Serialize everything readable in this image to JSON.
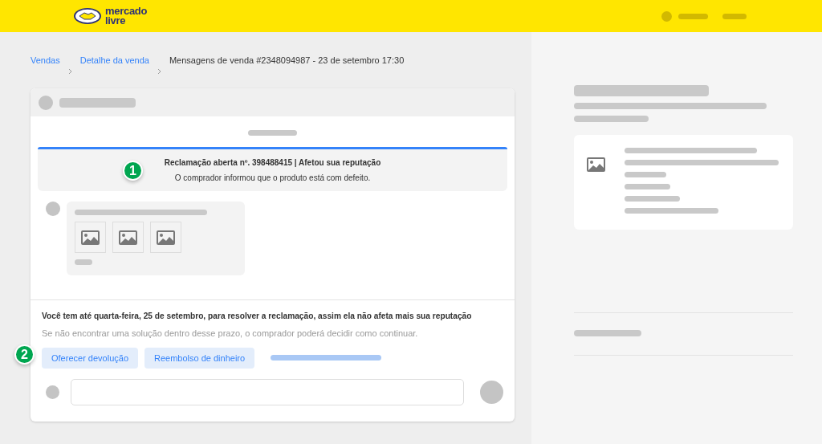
{
  "header": {
    "logo": [
      "mercado",
      "livre"
    ]
  },
  "breadcrumb": [
    {
      "label": "Vendas",
      "link": true
    },
    {
      "label": "Detalhe da venda",
      "link": true
    },
    {
      "label": "Mensagens de venda #2348094987 - 23 de setembro 17:30",
      "link": false
    }
  ],
  "claim": {
    "title": "Reclamação aberta nº. 398488415  | Afetou sua reputação",
    "description": "O comprador informou que o produto está com defeito.",
    "marker": "1"
  },
  "deadline": {
    "text": "Você tem até quarta-feira, 25 de setembro, para resolver a reclamação, assim ela não afeta mais sua reputação",
    "note": "Se não encontrar uma solução dentro desse prazo, o comprador poderá decidir como continuar.",
    "marker": "2"
  },
  "actions": [
    "Oferecer devolução",
    "Reembolso de dinheiro"
  ]
}
